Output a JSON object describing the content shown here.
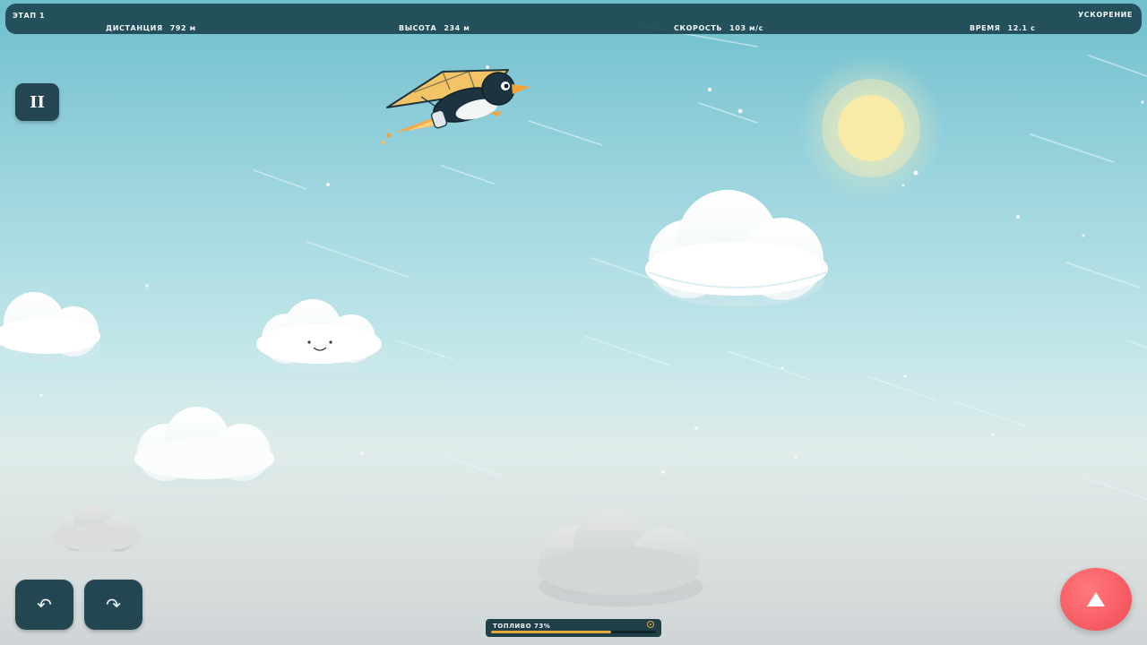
{
  "hud": {
    "stage": "ЭТАП 1",
    "boost": "УСКОРЕНИЕ",
    "distance_label": "ДИСТАНЦИЯ",
    "distance_value": "792 м",
    "altitude_label": "ВЫСОТА",
    "altitude_value": "234 м",
    "speed_label": "СКОРОСТЬ",
    "speed_value": "103 м/с",
    "time_label": "ВРЕМЯ",
    "time_value": "12.1 с"
  },
  "controls": {
    "pause_label": "II",
    "undo_label": "↶",
    "redo_label": "↷"
  },
  "fuel": {
    "label": "ТОПЛИВО",
    "percent_text": "73%",
    "level": 0.73
  },
  "colors": {
    "hud_bg": "#18404a",
    "button_bg": "#234652",
    "fly_button": "#f04a55",
    "sun": "#f7eaa6",
    "glider_wing": "#f2c465",
    "fuel_fill": "#e3a93d"
  },
  "icons": {
    "pause": "pause-icon",
    "undo": "rotate-left-icon",
    "redo": "rotate-right-icon",
    "fly": "up-triangle-icon"
  }
}
